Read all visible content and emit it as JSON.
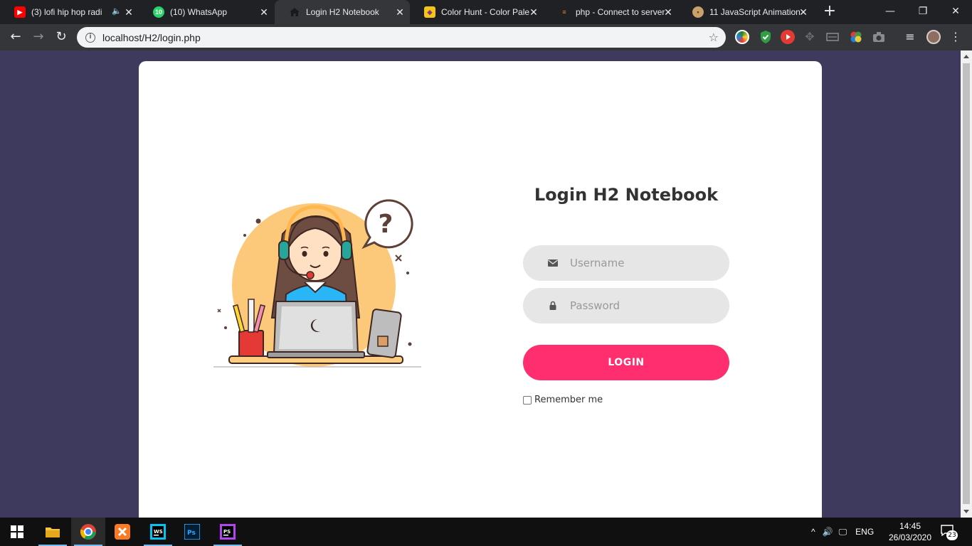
{
  "browser": {
    "tabs": [
      {
        "title": "(3) lofi hip hop radi",
        "favicon": "youtube-icon",
        "color": "#ff0000",
        "audio": true,
        "active": false
      },
      {
        "title": "(10) WhatsApp",
        "favicon": "whatsapp-icon",
        "color": "#25d366",
        "badge": "10",
        "audio": false,
        "active": false
      },
      {
        "title": "Login H2 Notebook",
        "favicon": "home-icon",
        "color": "#1a1a1a",
        "audio": false,
        "active": true
      },
      {
        "title": "Color Hunt - Color Pale",
        "favicon": "color-hunt-icon",
        "color": "#f5c518",
        "audio": false,
        "active": false
      },
      {
        "title": "php - Connect to server",
        "favicon": "stackoverflow-icon",
        "color": "#f48024",
        "audio": false,
        "active": false
      },
      {
        "title": "11 JavaScript Animation",
        "favicon": "monkey-icon",
        "color": "#c8a06a",
        "audio": false,
        "active": false
      }
    ],
    "new_tab_label": "+",
    "url": "localhost/H2/login.php"
  },
  "page": {
    "title": "Login H2 Notebook",
    "username_placeholder": "Username",
    "password_placeholder": "Password",
    "login_label": "LOGIN",
    "remember_label": "Remember me",
    "colors": {
      "background": "#3d3a5e",
      "accent": "#ff2e6e",
      "input_bg": "#e6e6e6"
    }
  },
  "taskbar": {
    "apps": [
      "start-icon",
      "file-explorer-icon",
      "chrome-icon",
      "xampp-icon",
      "webstorm-icon",
      "photoshop-icon",
      "phpstorm-icon"
    ],
    "language": "ENG",
    "time": "14:45",
    "date": "26/03/2020",
    "notification_count": "23"
  }
}
